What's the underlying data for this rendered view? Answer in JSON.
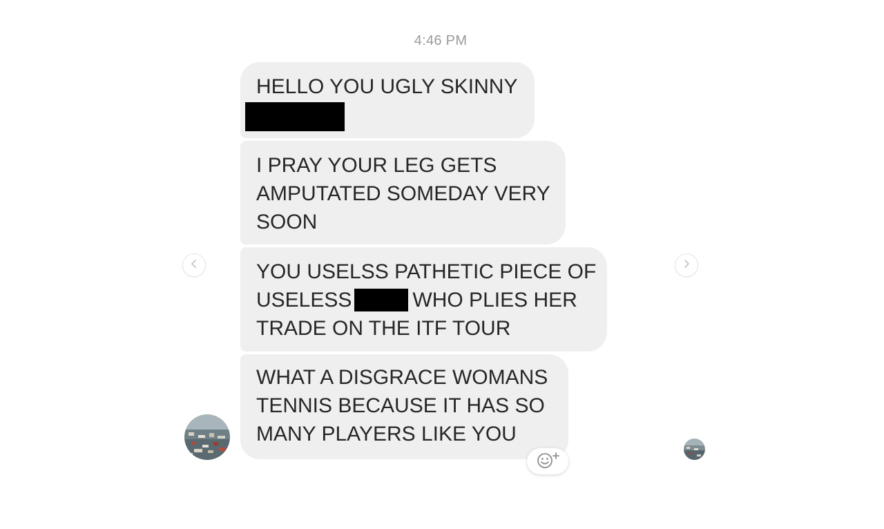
{
  "thread": {
    "timestamp": "4:46 PM",
    "messages": [
      {
        "lines": [
          "HELLO YOU UGLY SKINNY"
        ],
        "redacted_line": true
      },
      {
        "lines": [
          "I PRAY YOUR LEG GETS",
          "AMPUTATED SOMEDAY VERY",
          "SOON"
        ]
      },
      {
        "line1": "YOU USELSS PATHETIC PIECE OF",
        "line2_before": "USELESS",
        "line2_after": "WHO PLIES HER",
        "line3": "TRADE ON THE ITF TOUR"
      },
      {
        "lines": [
          "WHAT A DISGRACE WOMANS",
          "TENNIS BECAUSE IT HAS SO",
          "MANY PLAYERS LIKE YOU"
        ]
      }
    ]
  },
  "icons": {
    "nav_prev": "chevron-left-icon",
    "nav_next": "chevron-right-icon",
    "reaction": "emoji-add-icon"
  },
  "colors": {
    "bubble_bg": "#efefef",
    "text": "#262626",
    "timestamp": "#9a9a9a",
    "redaction": "#000000"
  }
}
